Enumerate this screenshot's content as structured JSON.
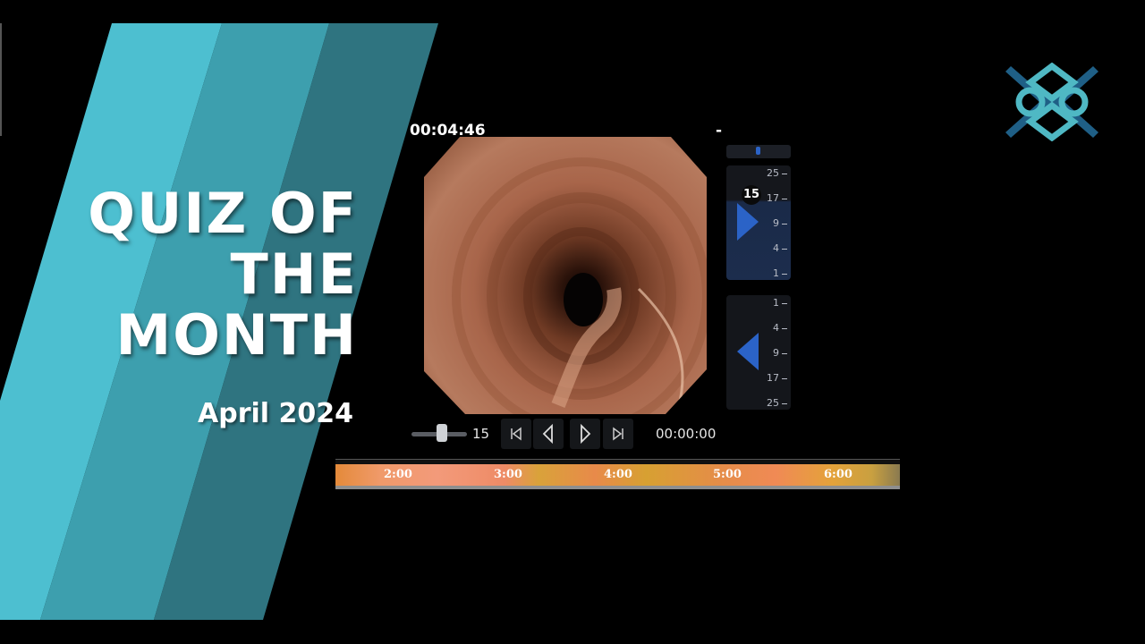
{
  "title": {
    "lines": [
      "QUIZ OF",
      "THE",
      "MONTH"
    ],
    "subtitle": "April 2024"
  },
  "viewer": {
    "timestamp": "00:04:46",
    "dash": "-",
    "top_panel": {
      "ticks": [
        "25",
        "17",
        "9",
        "4",
        "1"
      ],
      "current_level": "15"
    },
    "bottom_panel": {
      "ticks": [
        "1",
        "4",
        "9",
        "17",
        "25"
      ]
    },
    "controls": {
      "speed_value": "15",
      "speed_fraction": 0.55,
      "play_time": "00:00:00"
    },
    "timeline": {
      "labels": [
        "2:00",
        "3:00",
        "4:00",
        "5:00",
        "6:00"
      ]
    }
  },
  "colors": {
    "stripe_light": "#4dbfd0",
    "stripe_mid": "#3d9fae",
    "stripe_dark": "#2f7480",
    "panel_blue": "#2b63c7",
    "logo_teal": "#4fb8c4",
    "logo_dark": "#1f5f86"
  },
  "icons": {
    "skip_back": "skip-back-icon",
    "step_back": "step-back-icon",
    "play": "play-icon",
    "skip_forward": "skip-forward-icon",
    "logo": "logo-icon"
  }
}
